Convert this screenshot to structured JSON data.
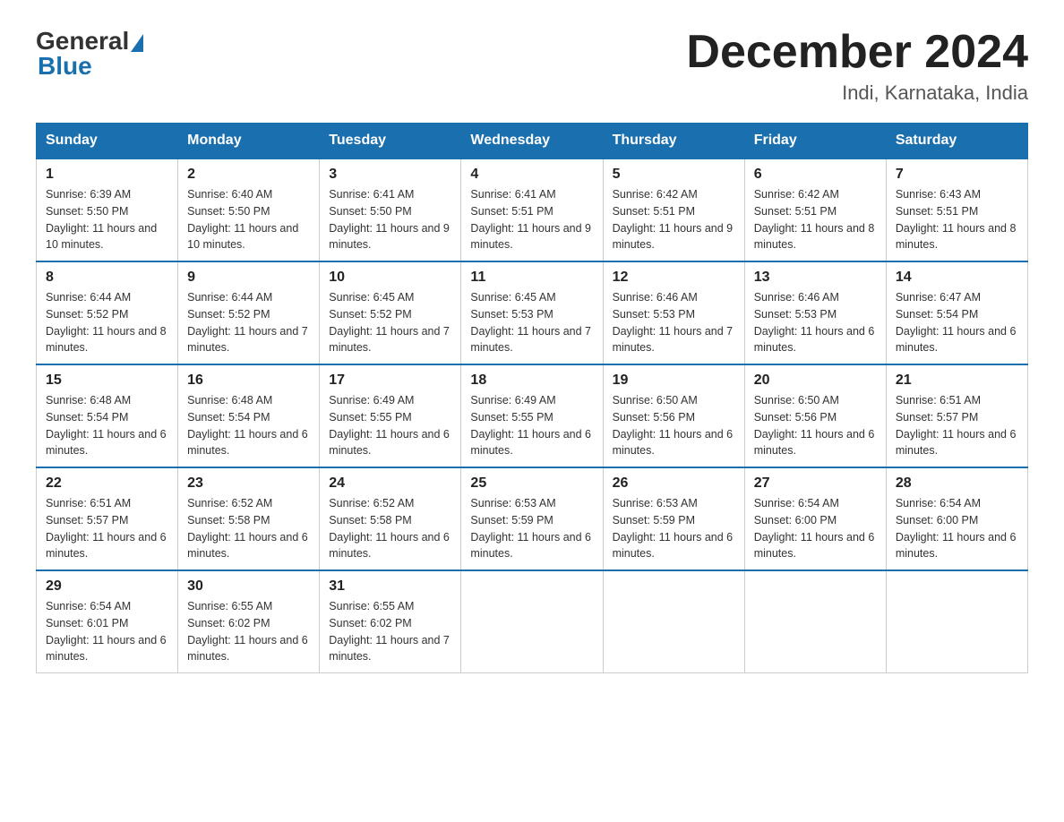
{
  "logo": {
    "general": "General",
    "blue": "Blue"
  },
  "title": "December 2024",
  "location": "Indi, Karnataka, India",
  "headers": [
    "Sunday",
    "Monday",
    "Tuesday",
    "Wednesday",
    "Thursday",
    "Friday",
    "Saturday"
  ],
  "weeks": [
    [
      {
        "day": "1",
        "sunrise": "6:39 AM",
        "sunset": "5:50 PM",
        "daylight": "11 hours and 10 minutes."
      },
      {
        "day": "2",
        "sunrise": "6:40 AM",
        "sunset": "5:50 PM",
        "daylight": "11 hours and 10 minutes."
      },
      {
        "day": "3",
        "sunrise": "6:41 AM",
        "sunset": "5:50 PM",
        "daylight": "11 hours and 9 minutes."
      },
      {
        "day": "4",
        "sunrise": "6:41 AM",
        "sunset": "5:51 PM",
        "daylight": "11 hours and 9 minutes."
      },
      {
        "day": "5",
        "sunrise": "6:42 AM",
        "sunset": "5:51 PM",
        "daylight": "11 hours and 9 minutes."
      },
      {
        "day": "6",
        "sunrise": "6:42 AM",
        "sunset": "5:51 PM",
        "daylight": "11 hours and 8 minutes."
      },
      {
        "day": "7",
        "sunrise": "6:43 AM",
        "sunset": "5:51 PM",
        "daylight": "11 hours and 8 minutes."
      }
    ],
    [
      {
        "day": "8",
        "sunrise": "6:44 AM",
        "sunset": "5:52 PM",
        "daylight": "11 hours and 8 minutes."
      },
      {
        "day": "9",
        "sunrise": "6:44 AM",
        "sunset": "5:52 PM",
        "daylight": "11 hours and 7 minutes."
      },
      {
        "day": "10",
        "sunrise": "6:45 AM",
        "sunset": "5:52 PM",
        "daylight": "11 hours and 7 minutes."
      },
      {
        "day": "11",
        "sunrise": "6:45 AM",
        "sunset": "5:53 PM",
        "daylight": "11 hours and 7 minutes."
      },
      {
        "day": "12",
        "sunrise": "6:46 AM",
        "sunset": "5:53 PM",
        "daylight": "11 hours and 7 minutes."
      },
      {
        "day": "13",
        "sunrise": "6:46 AM",
        "sunset": "5:53 PM",
        "daylight": "11 hours and 6 minutes."
      },
      {
        "day": "14",
        "sunrise": "6:47 AM",
        "sunset": "5:54 PM",
        "daylight": "11 hours and 6 minutes."
      }
    ],
    [
      {
        "day": "15",
        "sunrise": "6:48 AM",
        "sunset": "5:54 PM",
        "daylight": "11 hours and 6 minutes."
      },
      {
        "day": "16",
        "sunrise": "6:48 AM",
        "sunset": "5:54 PM",
        "daylight": "11 hours and 6 minutes."
      },
      {
        "day": "17",
        "sunrise": "6:49 AM",
        "sunset": "5:55 PM",
        "daylight": "11 hours and 6 minutes."
      },
      {
        "day": "18",
        "sunrise": "6:49 AM",
        "sunset": "5:55 PM",
        "daylight": "11 hours and 6 minutes."
      },
      {
        "day": "19",
        "sunrise": "6:50 AM",
        "sunset": "5:56 PM",
        "daylight": "11 hours and 6 minutes."
      },
      {
        "day": "20",
        "sunrise": "6:50 AM",
        "sunset": "5:56 PM",
        "daylight": "11 hours and 6 minutes."
      },
      {
        "day": "21",
        "sunrise": "6:51 AM",
        "sunset": "5:57 PM",
        "daylight": "11 hours and 6 minutes."
      }
    ],
    [
      {
        "day": "22",
        "sunrise": "6:51 AM",
        "sunset": "5:57 PM",
        "daylight": "11 hours and 6 minutes."
      },
      {
        "day": "23",
        "sunrise": "6:52 AM",
        "sunset": "5:58 PM",
        "daylight": "11 hours and 6 minutes."
      },
      {
        "day": "24",
        "sunrise": "6:52 AM",
        "sunset": "5:58 PM",
        "daylight": "11 hours and 6 minutes."
      },
      {
        "day": "25",
        "sunrise": "6:53 AM",
        "sunset": "5:59 PM",
        "daylight": "11 hours and 6 minutes."
      },
      {
        "day": "26",
        "sunrise": "6:53 AM",
        "sunset": "5:59 PM",
        "daylight": "11 hours and 6 minutes."
      },
      {
        "day": "27",
        "sunrise": "6:54 AM",
        "sunset": "6:00 PM",
        "daylight": "11 hours and 6 minutes."
      },
      {
        "day": "28",
        "sunrise": "6:54 AM",
        "sunset": "6:00 PM",
        "daylight": "11 hours and 6 minutes."
      }
    ],
    [
      {
        "day": "29",
        "sunrise": "6:54 AM",
        "sunset": "6:01 PM",
        "daylight": "11 hours and 6 minutes."
      },
      {
        "day": "30",
        "sunrise": "6:55 AM",
        "sunset": "6:02 PM",
        "daylight": "11 hours and 6 minutes."
      },
      {
        "day": "31",
        "sunrise": "6:55 AM",
        "sunset": "6:02 PM",
        "daylight": "11 hours and 7 minutes."
      },
      null,
      null,
      null,
      null
    ]
  ],
  "labels": {
    "sunrise": "Sunrise:",
    "sunset": "Sunset:",
    "daylight": "Daylight:"
  }
}
